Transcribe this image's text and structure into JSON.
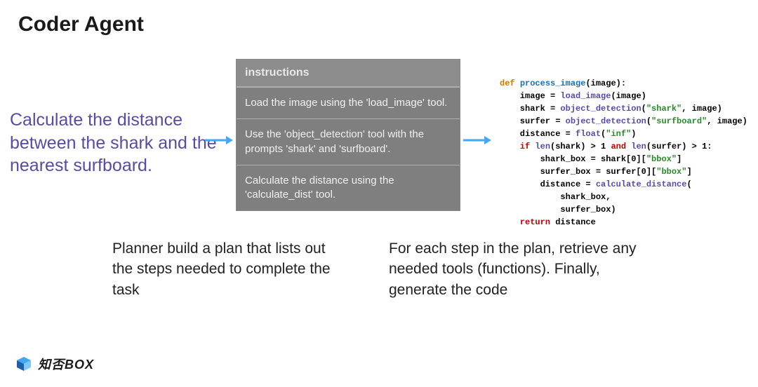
{
  "title": "Coder Agent",
  "prompt_text": "Calculate the distance between the shark and the nearest surfboard.",
  "plan": {
    "header": "instructions",
    "rows": [
      "Load the image using the 'load_image' tool.",
      "Use the 'object_detection' tool with the prompts 'shark' and 'surfboard'.",
      "Calculate the distance using the 'calculate_dist' tool."
    ]
  },
  "code": {
    "line1_def": "def ",
    "line1_fn": "process_image",
    "line1_rest": "(image):",
    "line2_a": "    image = ",
    "line2_b": "load_image",
    "line2_c": "(image)",
    "line3_a": "    shark = ",
    "line3_b": "object_detection",
    "line3_c": "(",
    "line3_d": "\"shark\"",
    "line3_e": ", image)",
    "line4_a": "    surfer = ",
    "line4_b": "object_detection",
    "line4_c": "(",
    "line4_d": "\"surfboard\"",
    "line4_e": ", image)",
    "line5_a": "    distance = ",
    "line5_b": "float",
    "line5_c": "(",
    "line5_d": "\"inf\"",
    "line5_e": ")",
    "line6_a": "    if ",
    "line6_b": "len",
    "line6_c": "(shark) > 1 ",
    "line6_d": "and ",
    "line6_e": "len",
    "line6_f": "(surfer) > 1:",
    "line7": "        shark_box = shark[0][",
    "line7_b": "\"bbox\"",
    "line7_c": "]",
    "line8": "        surfer_box = surfer[0][",
    "line8_b": "\"bbox\"",
    "line8_c": "]",
    "line9_a": "        distance = ",
    "line9_b": "calculate_distance",
    "line9_c": "(",
    "line10": "            shark_box,",
    "line11": "            surfer_box)",
    "line12_a": "    return ",
    "line12_b": "distance"
  },
  "caption1": "Planner build a plan that lists out the steps needed to complete the task",
  "caption2": "For each step in the plan, retrieve any needed tools (functions). Finally, generate the code",
  "watermark": "知否BOX"
}
